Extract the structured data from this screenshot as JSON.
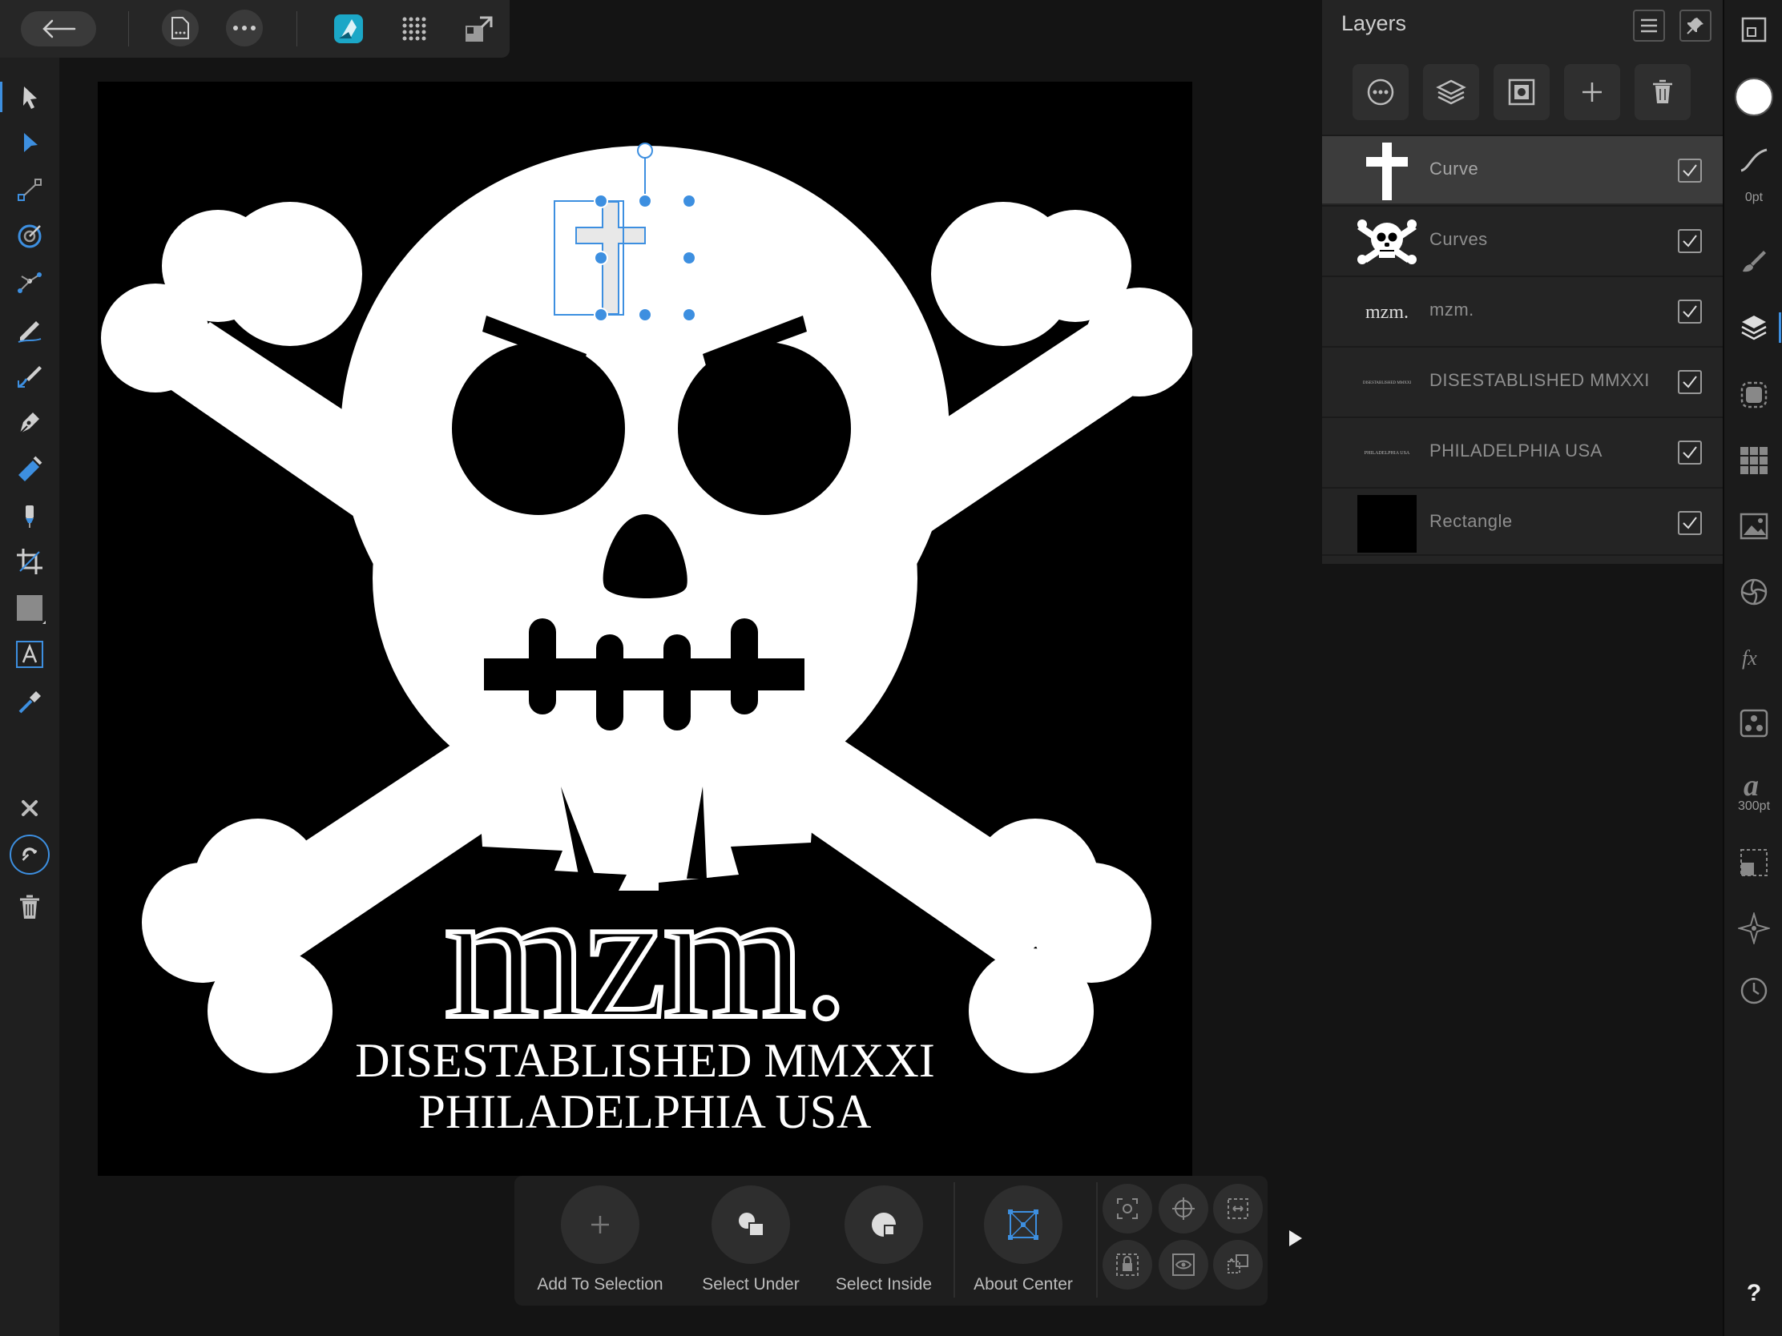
{
  "layers_panel": {
    "title": "Layers",
    "layers": [
      {
        "name": "Curve",
        "thumb": "cross",
        "visible": true,
        "selected": true
      },
      {
        "name": "Curves",
        "thumb": "skull",
        "visible": true,
        "selected": false
      },
      {
        "name": "mzm.",
        "thumb": "text-mzm",
        "visible": true,
        "selected": false
      },
      {
        "name": "DISESTABLISHED MMXXI",
        "thumb": "text-small",
        "visible": true,
        "selected": false
      },
      {
        "name": "PHILADELPHIA USA",
        "thumb": "text-small",
        "visible": true,
        "selected": false
      },
      {
        "name": "Rectangle",
        "thumb": "black-rect",
        "visible": true,
        "selected": false
      }
    ],
    "thumb_text": {
      "mzm": "mzm.",
      "diss": "DISESTABLISHED MMXXI",
      "phil": "PHILADELPHIA USA"
    }
  },
  "studio": {
    "stroke_width": "0pt",
    "font_size": "300pt",
    "help": "?"
  },
  "artwork": {
    "logo": "mzm.",
    "line1": "DISESTABLISHED MMXXI",
    "line2": "PHILADELPHIA USA"
  },
  "context_bar": {
    "add_to_selection": "Add To Selection",
    "select_under": "Select Under",
    "select_inside": "Select Inside",
    "about_center": "About Center"
  },
  "colors": {
    "accent": "#3d8fe0",
    "panel": "#242424",
    "canvas": "#000000",
    "art": "#ffffff"
  }
}
